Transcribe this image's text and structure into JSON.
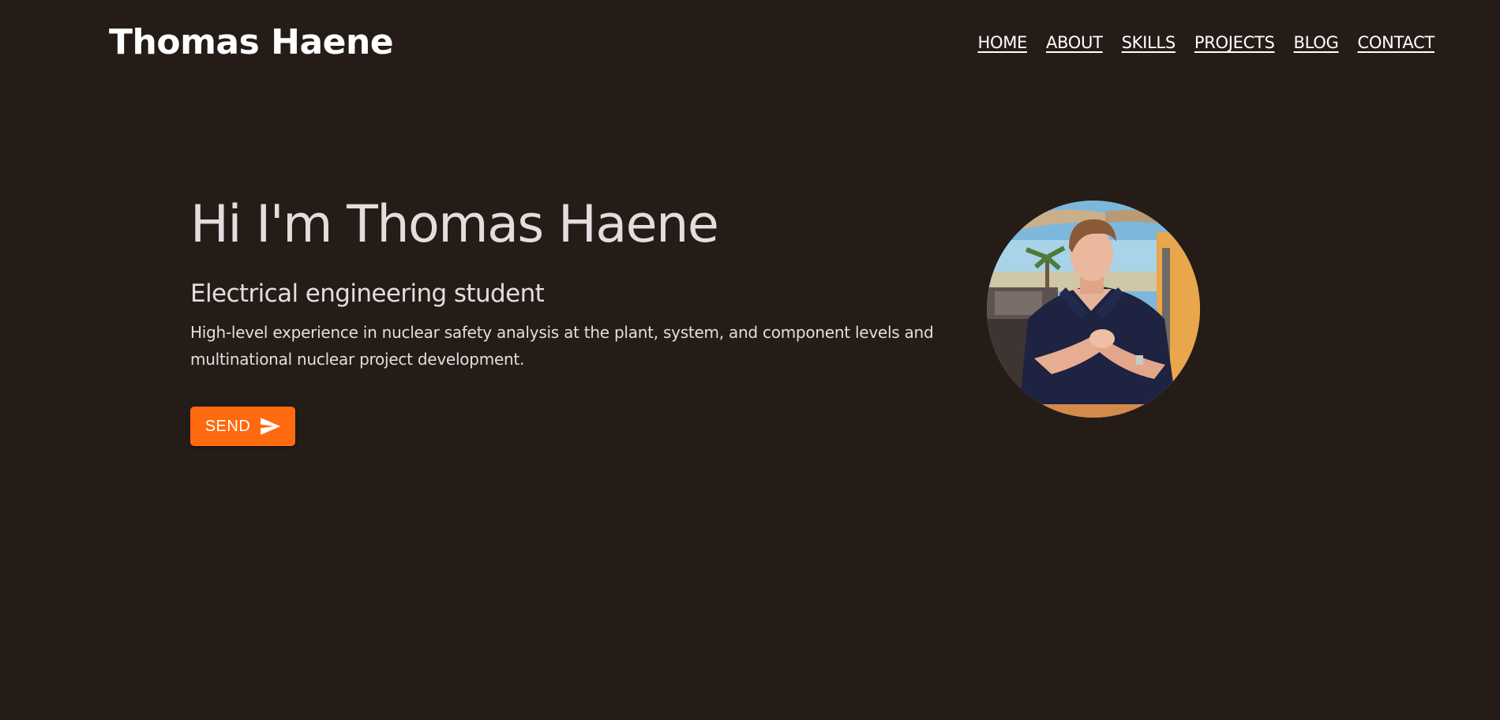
{
  "header": {
    "brand": "Thomas Haene",
    "nav": [
      "HOME",
      "ABOUT",
      "SKILLS",
      "PROJECTS",
      "BLOG",
      "CONTACT"
    ]
  },
  "hero": {
    "title": "Hi I'm Thomas Haene",
    "subtitle": "Electrical engineering student",
    "description": "High-level experience in nuclear safety analysis at the plant, system, and component levels and multinational nuclear project development.",
    "button_label": "SEND",
    "button_icon": "send-icon"
  },
  "colors": {
    "background": "#251c18",
    "accent": "#fd6a0f",
    "text": "#e3dddd"
  }
}
